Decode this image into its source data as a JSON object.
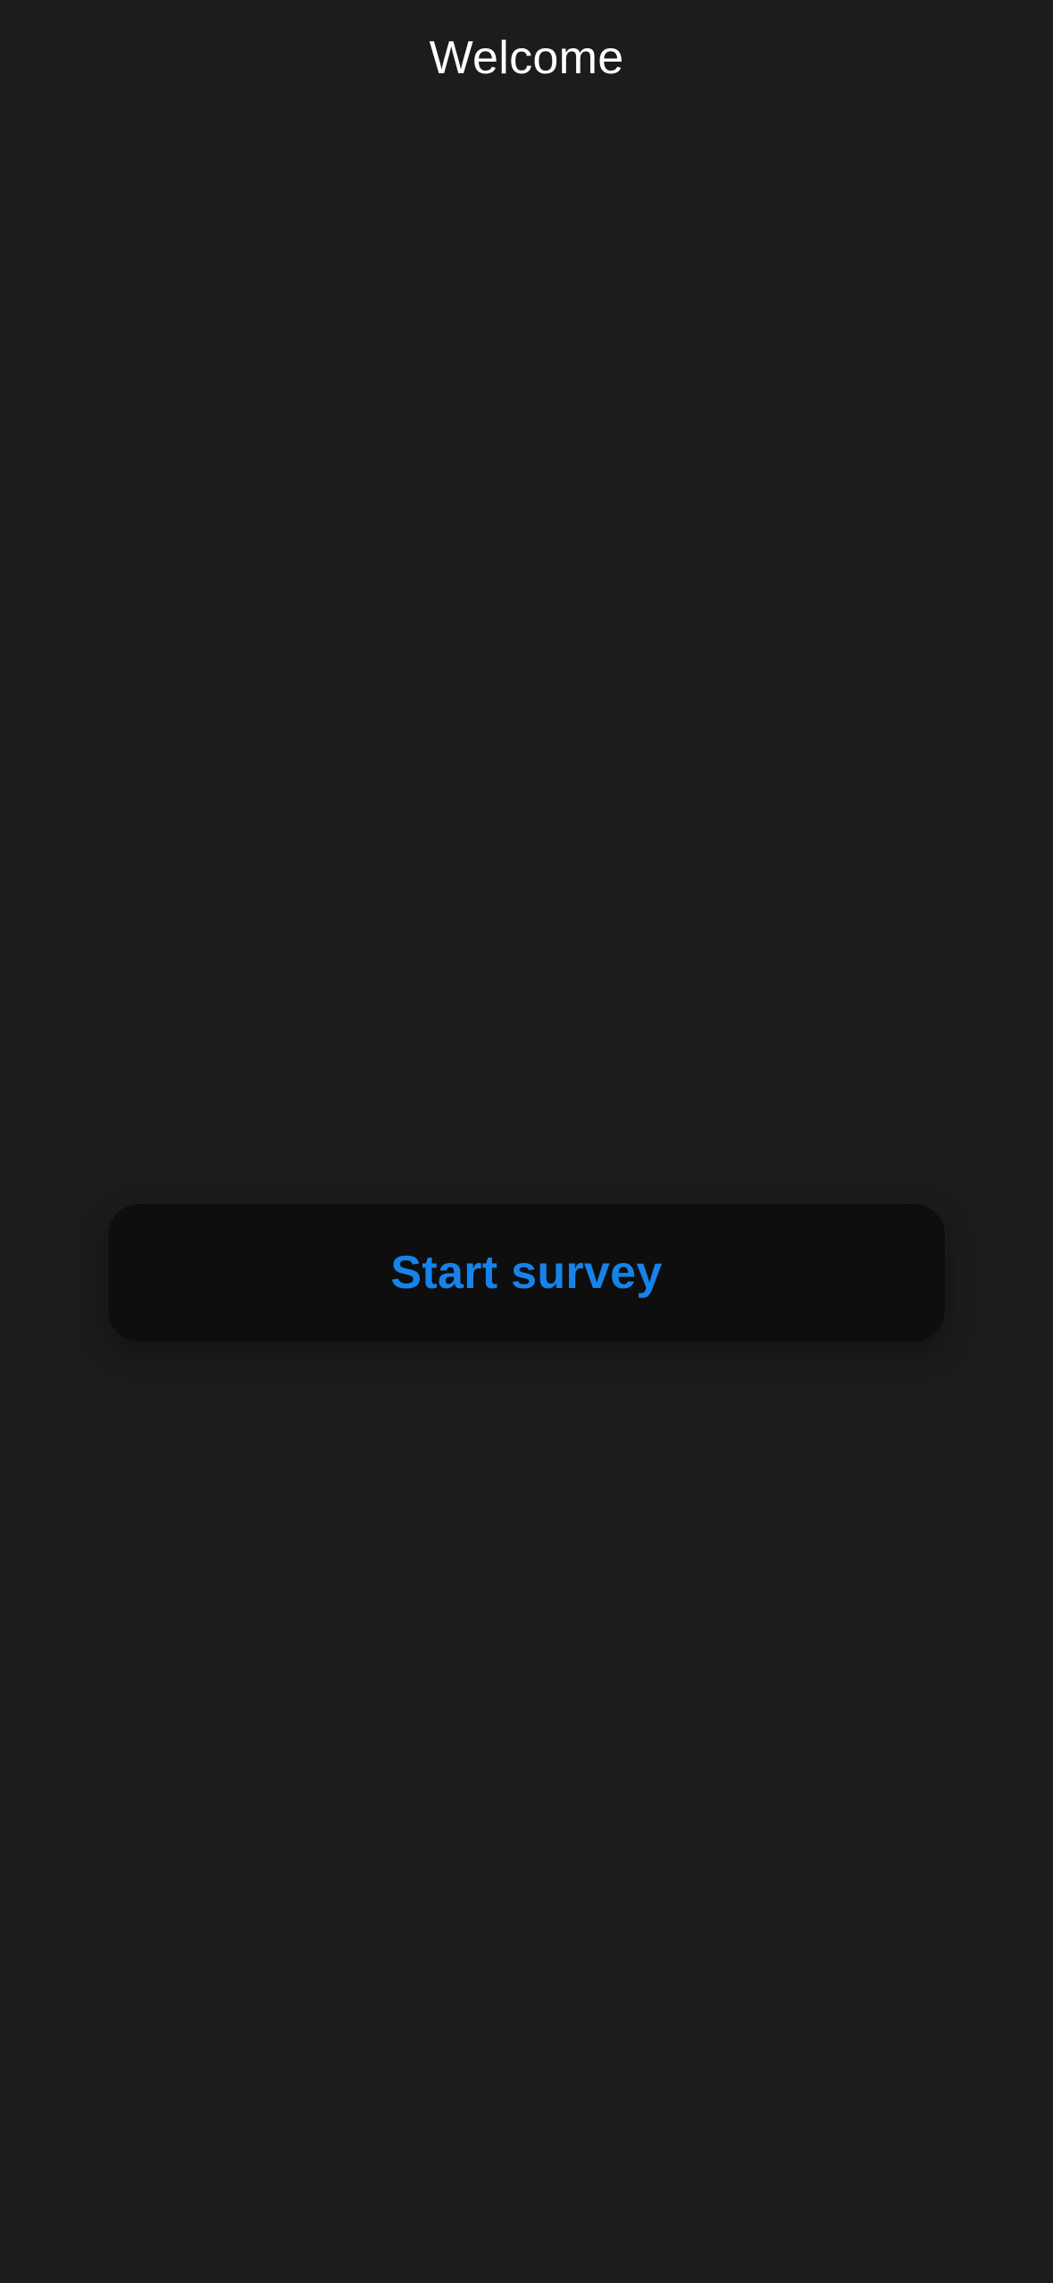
{
  "header": {
    "title": "Welcome"
  },
  "main": {
    "start_button": {
      "label": "Start survey"
    }
  },
  "colors": {
    "background": "#1c1c1e",
    "button_background": "#0e0e0f",
    "accent": "#1783ea",
    "title_text": "#ffffff"
  }
}
